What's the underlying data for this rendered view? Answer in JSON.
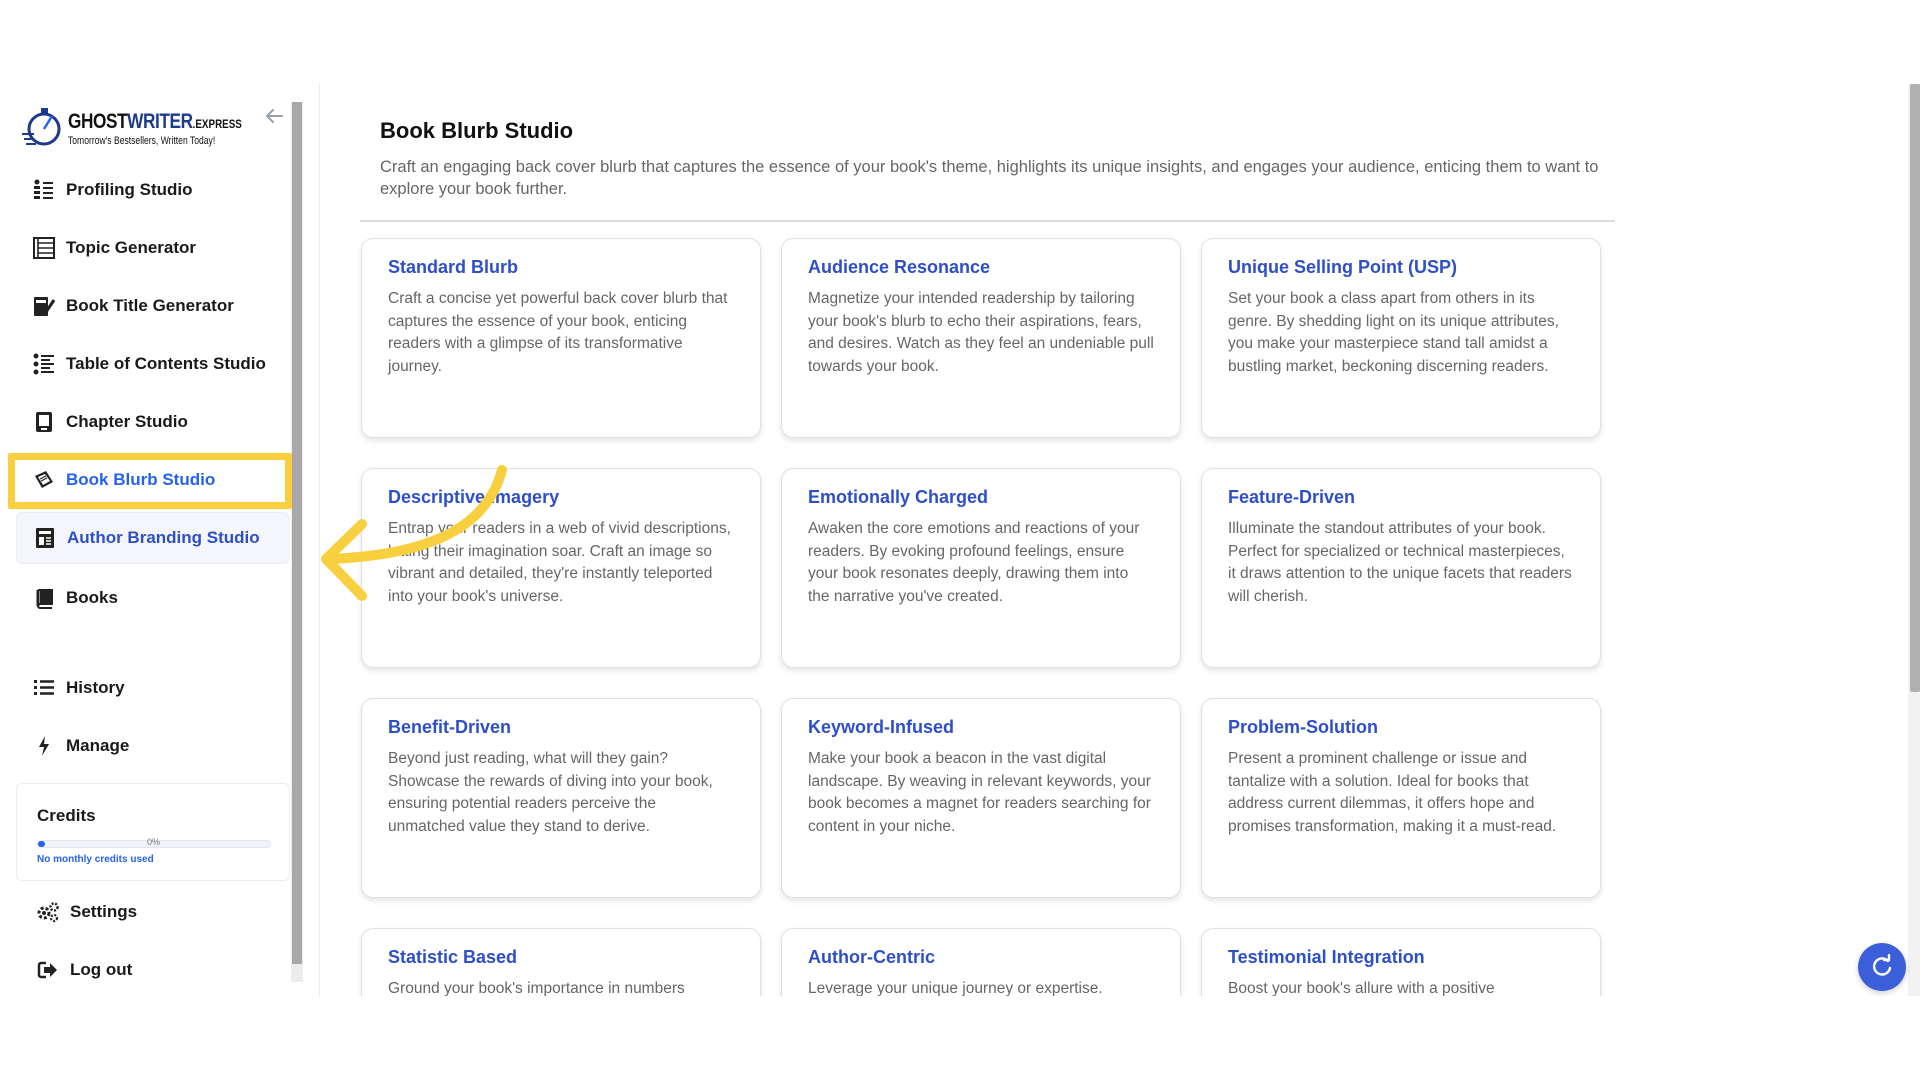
{
  "brand": {
    "logo_word_a": "GHOST",
    "logo_word_b": "WRITER",
    "logo_suffix": ".EXPRESS",
    "tagline": "Tomorrow's Bestsellers, Written Today!",
    "accent_color": "#2563eb",
    "highlight_color": "#f8cf3f"
  },
  "sidebar": {
    "items": [
      {
        "label": "Profiling Studio",
        "icon": "profiling-icon"
      },
      {
        "label": "Topic Generator",
        "icon": "topic-list-icon"
      },
      {
        "label": "Book Title Generator",
        "icon": "book-pen-icon"
      },
      {
        "label": "Table of Contents Studio",
        "icon": "toc-list-icon"
      },
      {
        "label": "Chapter Studio",
        "icon": "chapter-book-icon"
      },
      {
        "label": "Book Blurb Studio",
        "icon": "blurb-book-icon",
        "active": true
      },
      {
        "label": "Author Branding Studio",
        "icon": "author-branding-icon"
      },
      {
        "label": "Books",
        "icon": "books-icon"
      },
      {
        "label": "History",
        "icon": "history-list-icon"
      },
      {
        "label": "Manage",
        "icon": "lightning-icon"
      },
      {
        "label": "Settings",
        "icon": "gears-icon"
      },
      {
        "label": "Log out",
        "icon": "logout-icon"
      }
    ],
    "credits": {
      "title": "Credits",
      "percent_label": "0%",
      "progress": 0.03,
      "note": "No monthly credits used"
    }
  },
  "main": {
    "title": "Book Blurb Studio",
    "description": "Craft an engaging back cover blurb that captures the essence of your book's theme, highlights its unique insights, and engages your audience, enticing them to want to explore your book further.",
    "cards": [
      {
        "title": "Standard Blurb",
        "desc": "Craft a concise yet powerful back cover blurb that captures the essence of your book, enticing readers with a glimpse of its transformative journey."
      },
      {
        "title": "Audience Resonance",
        "desc": "Magnetize your intended readership by tailoring your book's blurb to echo their aspirations, fears, and desires. Watch as they feel an undeniable pull towards your book."
      },
      {
        "title": "Unique Selling Point (USP)",
        "desc": "Set your book a class apart from others in its genre. By shedding light on its unique attributes, you make your masterpiece stand tall amidst a bustling market, beckoning discerning readers."
      },
      {
        "title": "Descriptive Imagery",
        "desc": "Entrap your readers in a web of vivid descriptions, letting their imagination soar. Craft an image so vibrant and detailed, they're instantly teleported into your book's universe."
      },
      {
        "title": "Emotionally Charged",
        "desc": "Awaken the core emotions and reactions of your readers. By evoking profound feelings, ensure your book resonates deeply, drawing them into the narrative you've created."
      },
      {
        "title": "Feature-Driven",
        "desc": "Illuminate the standout attributes of your book. Perfect for specialized or technical masterpieces, it draws attention to the unique facets that readers will cherish."
      },
      {
        "title": "Benefit-Driven",
        "desc": "Beyond just reading, what will they gain? Showcase the rewards of diving into your book, ensuring potential readers perceive the unmatched value they stand to derive."
      },
      {
        "title": "Keyword-Infused",
        "desc": "Make your book a beacon in the vast digital landscape. By weaving in relevant keywords, your book becomes a magnet for readers searching for content in your niche."
      },
      {
        "title": "Problem-Solution",
        "desc": "Present a prominent challenge or issue and tantalize with a solution. Ideal for books that address current dilemmas, it offers hope and promises transformation, making it a must-read."
      },
      {
        "title": "Statistic Based",
        "desc": "Ground your book's importance in numbers"
      },
      {
        "title": "Author-Centric",
        "desc": "Leverage your unique journey or expertise."
      },
      {
        "title": "Testimonial Integration",
        "desc": "Boost your book's allure with a positive"
      }
    ]
  }
}
